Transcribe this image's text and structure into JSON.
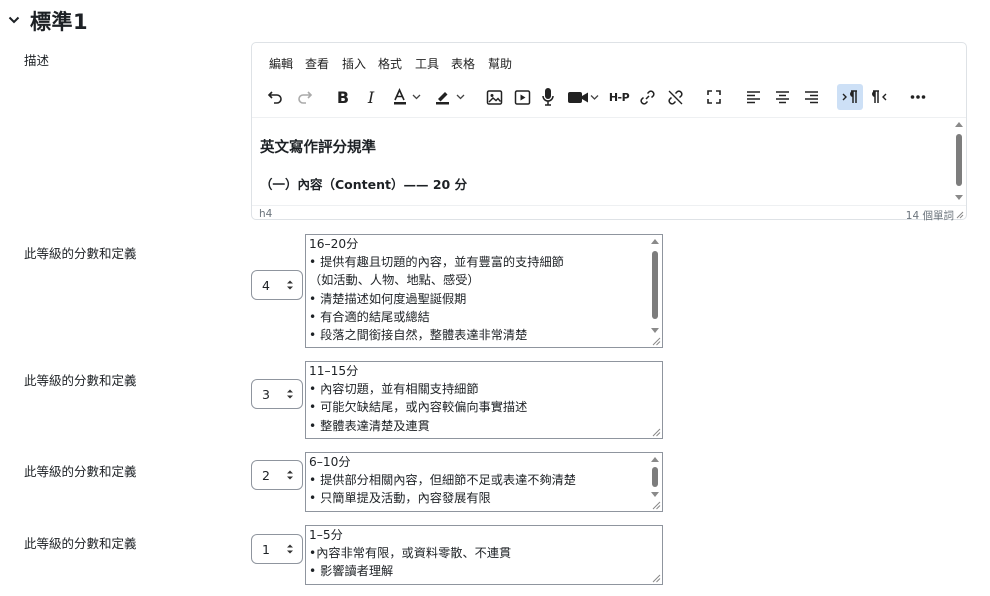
{
  "section": {
    "title": "標準1"
  },
  "description_label": "描述",
  "editor": {
    "menu": [
      "編輯",
      "查看",
      "插入",
      "格式",
      "工具",
      "表格",
      "幫助"
    ],
    "heading": "英文寫作評分規準",
    "subheading": "（一）內容（Content）—— 20 分",
    "path": "h4",
    "word_count": "14 個單詞"
  },
  "levels": [
    {
      "label": "此等級的分數和定義",
      "score": "4",
      "lines": [
        "16–20分",
        "• 提供有趣且切題的內容，並有豐富的支持細節",
        "（如活動、人物、地點、感受）",
        "• 清楚描述如何度過聖誕假期",
        "• 有合適的結尾或總結",
        "• 段落之間銜接自然，整體表達非常清楚"
      ]
    },
    {
      "label": "此等級的分數和定義",
      "score": "3",
      "lines": [
        "11–15分",
        "• 內容切題，並有相關支持細節",
        "• 可能欠缺結尾，或內容較偏向事實描述",
        "• 整體表達清楚及連貫"
      ]
    },
    {
      "label": "此等級的分數和定義",
      "score": "2",
      "lines": [
        "6–10分",
        "• 提供部分相關內容，但細節不足或表達不夠清楚",
        "• 只簡單提及活動，內容發展有限"
      ]
    },
    {
      "label": "此等級的分數和定義",
      "score": "1",
      "lines": [
        "1–5分",
        "•內容非常有限，或資料零散、不連貫",
        "• 影響讀者理解"
      ]
    }
  ]
}
